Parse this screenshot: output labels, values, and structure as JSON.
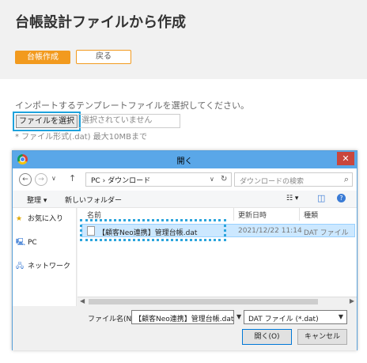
{
  "page": {
    "title": "台帳設計ファイルから作成",
    "create_button": "台帳作成",
    "back_button": "戻る",
    "instruction": "インポートするテンプレートファイルを選択してください。",
    "file_select_button": "ファイルを選択",
    "file_status": "選択されていません",
    "file_note": "* ファイル形式(.dat) 最大10MBまで"
  },
  "dialog": {
    "title": "開く",
    "close": "✕",
    "nav": {
      "back": "←",
      "forward": "→",
      "dropdown": "∨",
      "up": "↑",
      "path_root": "PC",
      "path_sep": "›",
      "path_folder": "ダウンロード",
      "path_dropdown": "∨",
      "refresh": "↻",
      "search_placeholder": "ダウンロードの検索",
      "search_icon": "⌕"
    },
    "commands": {
      "organize": "整理 ▾",
      "new_folder": "新しいフォルダー",
      "view": "☷ ▾",
      "pane": "◫",
      "help": "?"
    },
    "nav_pane": {
      "items": [
        {
          "icon": "★",
          "label": "お気に入り",
          "color": "#e0a800"
        },
        {
          "icon": "🖳",
          "label": "PC",
          "color": "#3a7bd5"
        },
        {
          "icon": "🖧",
          "label": "ネットワーク",
          "color": "#3a7bd5"
        }
      ]
    },
    "columns": {
      "name": "名前",
      "modified": "更新日時",
      "type": "種類"
    },
    "files": [
      {
        "name": "【顧客Neo連携】管理台帳.dat",
        "modified": "2021/12/22 11:14",
        "type": "DAT ファイル"
      }
    ],
    "scroll": {
      "left": "◀",
      "right": "▶"
    },
    "filename_label": "ファイル名(N):",
    "filename_value": "【顧客Neo連携】管理台帳.dat",
    "filename_arrow": "▼",
    "filetype_value": "DAT ファイル (*.dat)",
    "filetype_arrow": "▼",
    "open_button": "開く(O)",
    "cancel_button": "キャンセル"
  },
  "colors": {
    "accent": "#f29a1e",
    "highlight": "#1ea2dc",
    "titlebar": "#5aa7e8",
    "selection": "#cce8ff"
  }
}
